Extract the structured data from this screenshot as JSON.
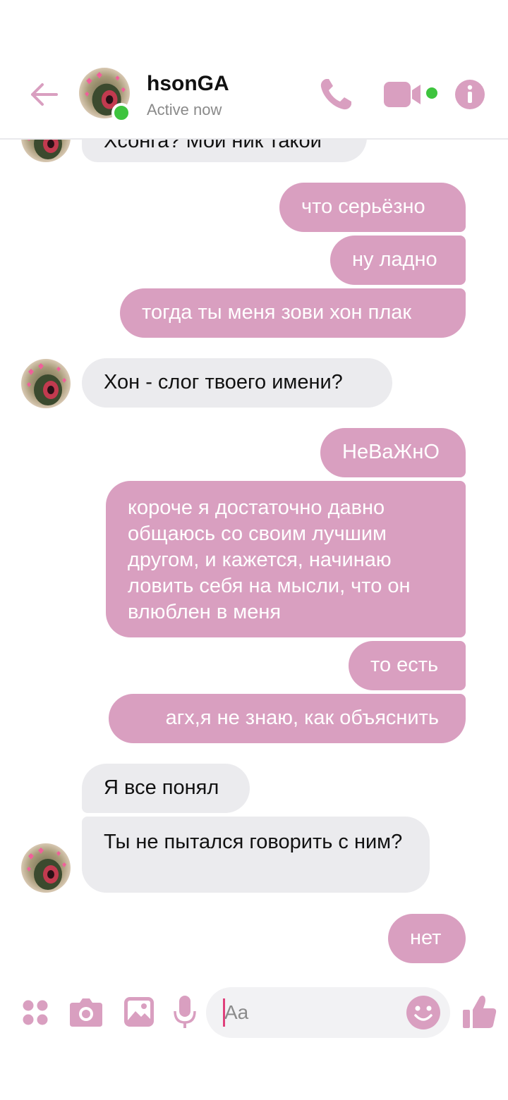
{
  "header": {
    "contact_name": "hsonGA",
    "status": "Active now",
    "icons": [
      "back-arrow-icon",
      "phone-icon",
      "video-camera-icon",
      "info-icon"
    ],
    "accent_color": "#d99fc0"
  },
  "messages": [
    {
      "side": "in",
      "text": "Хсонга? Мой ник такой"
    },
    {
      "side": "out",
      "text": "что серьёзно"
    },
    {
      "side": "out",
      "text": "ну ладно"
    },
    {
      "side": "out",
      "text": "тогда ты меня зови хон плак"
    },
    {
      "side": "in",
      "text": "Хон - слог твоего имени?"
    },
    {
      "side": "out",
      "text": "НеВаЖнО"
    },
    {
      "side": "out",
      "text": "короче я достаточно давно общаюсь со своим лучшим другом, и кажется, начинаю ловить себя на мысли, что он влюблен в меня"
    },
    {
      "side": "out",
      "text": "то есть"
    },
    {
      "side": "out",
      "text": "агх,я  не знаю, как объяснить"
    },
    {
      "side": "in",
      "text": "Я все понял"
    },
    {
      "side": "in",
      "text": "Ты не пытался говорить с ним?"
    },
    {
      "side": "out",
      "text": "нет"
    }
  ],
  "composer": {
    "placeholder": "Aa",
    "icons": [
      "apps-icon",
      "camera-icon",
      "image-icon",
      "microphone-icon",
      "emoji-icon",
      "thumbs-up-icon"
    ]
  },
  "colors": {
    "outgoing_bubble": "#d99fc0",
    "incoming_bubble": "#ebebee",
    "online_green": "#3ec43e"
  }
}
